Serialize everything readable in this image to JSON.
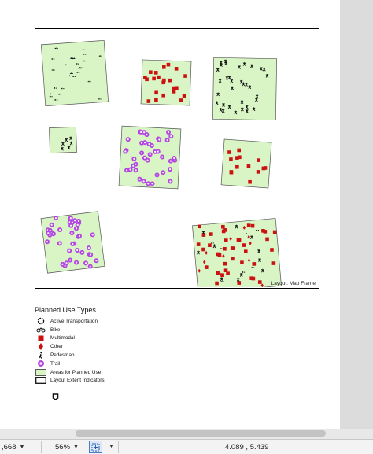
{
  "map_frame": {
    "caption": "Layout: Map Frame"
  },
  "legend": {
    "title": "Planned Use Types",
    "items": [
      {
        "label": "Active Transportation",
        "icon": "active-transportation-icon"
      },
      {
        "label": "Bike",
        "icon": "bike-icon"
      },
      {
        "label": "Multimodal",
        "icon": "multimodal-square-icon"
      },
      {
        "label": "Other",
        "icon": "other-diamond-icon"
      },
      {
        "label": "Pedestrian",
        "icon": "pedestrian-icon"
      },
      {
        "label": "Trail",
        "icon": "trail-circle-icon"
      },
      {
        "label": "Areas for Planned Use",
        "icon": "area-fill-icon"
      },
      {
        "label": "Layout Extent Indicators",
        "icon": "extent-outline-icon"
      }
    ]
  },
  "status_bar": {
    "scale_value": ",668",
    "zoom": "56%",
    "coordinates": "4.089 , 5.439"
  },
  "colors": {
    "area_fill": "#d9f5c6",
    "multimodal": "#cc1111",
    "trail": "#b347e0",
    "other": "#cc1111",
    "selection_blue": "#4a7bc8"
  }
}
